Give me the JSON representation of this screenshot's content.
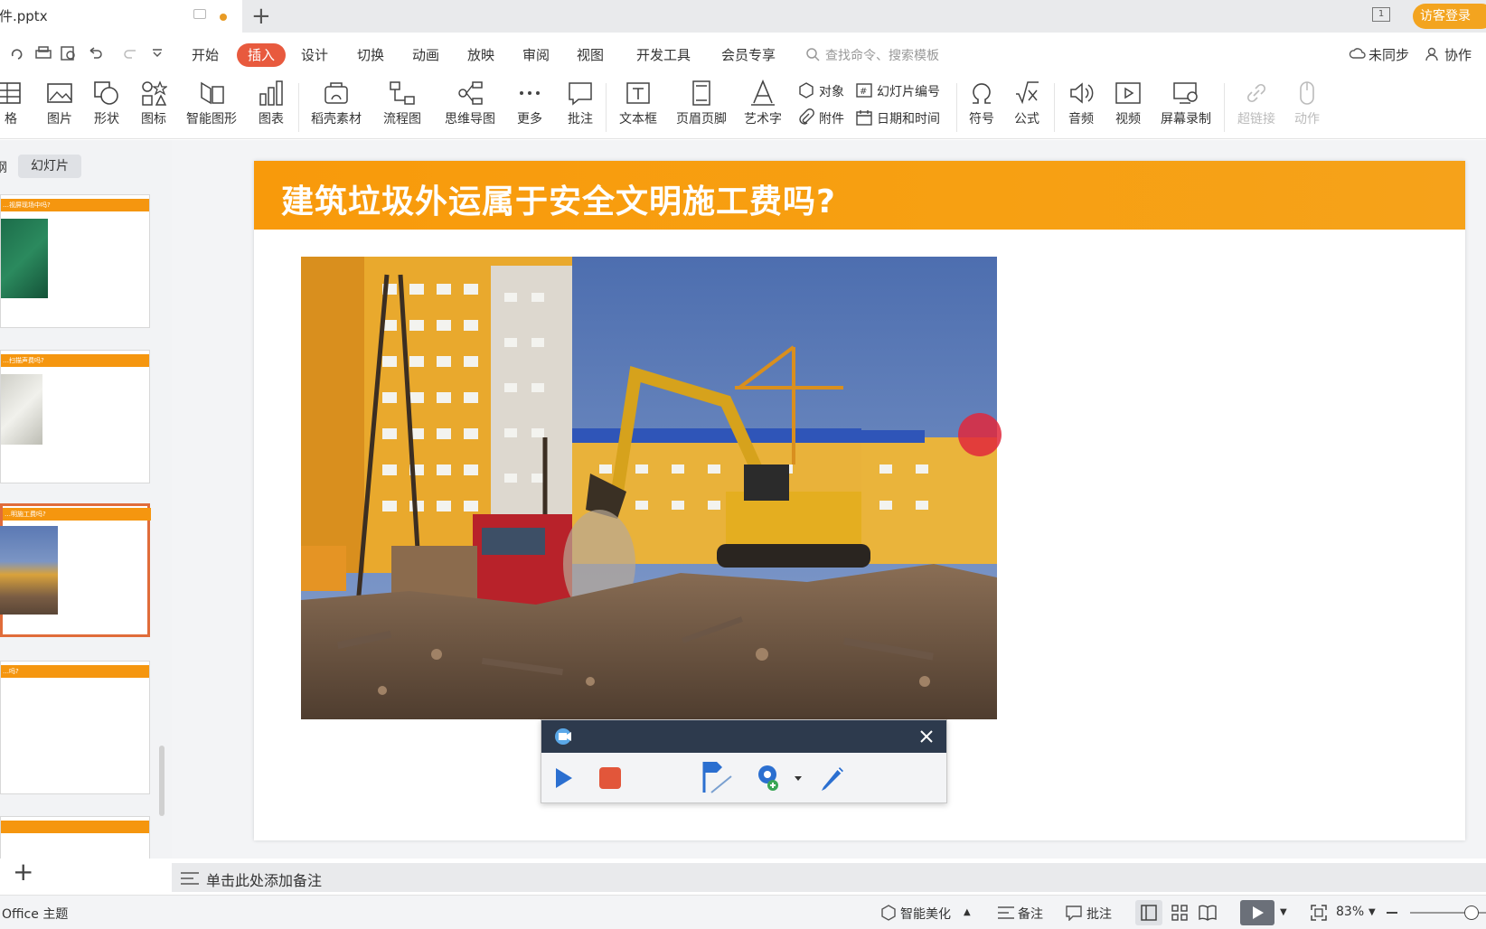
{
  "titlebar": {
    "file_name": "课件.pptx",
    "new_tab": "+",
    "login": "访客登录",
    "window_badge": "1"
  },
  "menu": {
    "items": [
      "开始",
      "插入",
      "设计",
      "切换",
      "动画",
      "放映",
      "审阅",
      "视图",
      "开发工具",
      "会员专享"
    ],
    "active": "插入",
    "search_placeholder": "查找命令、搜索模板",
    "sync": "未同步",
    "collab": "协作"
  },
  "ribbon": {
    "table": "格",
    "picture": "图片",
    "shape": "形状",
    "icon": "图标",
    "smartart": "智能图形",
    "chart": "图表",
    "docer": "稻壳素材",
    "flowchart": "流程图",
    "mindmap": "思维导图",
    "more": "更多",
    "comment": "批注",
    "textbox": "文本框",
    "header_footer": "页眉页脚",
    "wordart": "艺术字",
    "object": "对象",
    "slide_number": "幻灯片编号",
    "attachment": "附件",
    "datetime": "日期和时间",
    "symbol": "符号",
    "formula": "公式",
    "audio": "音频",
    "video": "视频",
    "screen_record": "屏幕录制",
    "hyperlink": "超链接",
    "action": "动作"
  },
  "sidebar": {
    "tab_outline": "纲",
    "tab_slides": "幻灯片",
    "thumbs": [
      "…视屏现场中吗?",
      "…扫描声费吗?",
      "…明施工费吗?",
      "…吗?",
      ""
    ]
  },
  "slide": {
    "title": "建筑垃圾外运属于安全文明施工费吗?"
  },
  "notes": {
    "placeholder": "单击此处添加备注"
  },
  "status": {
    "theme": "Office 主题",
    "beautify": "智能美化",
    "notes": "备注",
    "comment": "批注",
    "zoom": "83%"
  }
}
